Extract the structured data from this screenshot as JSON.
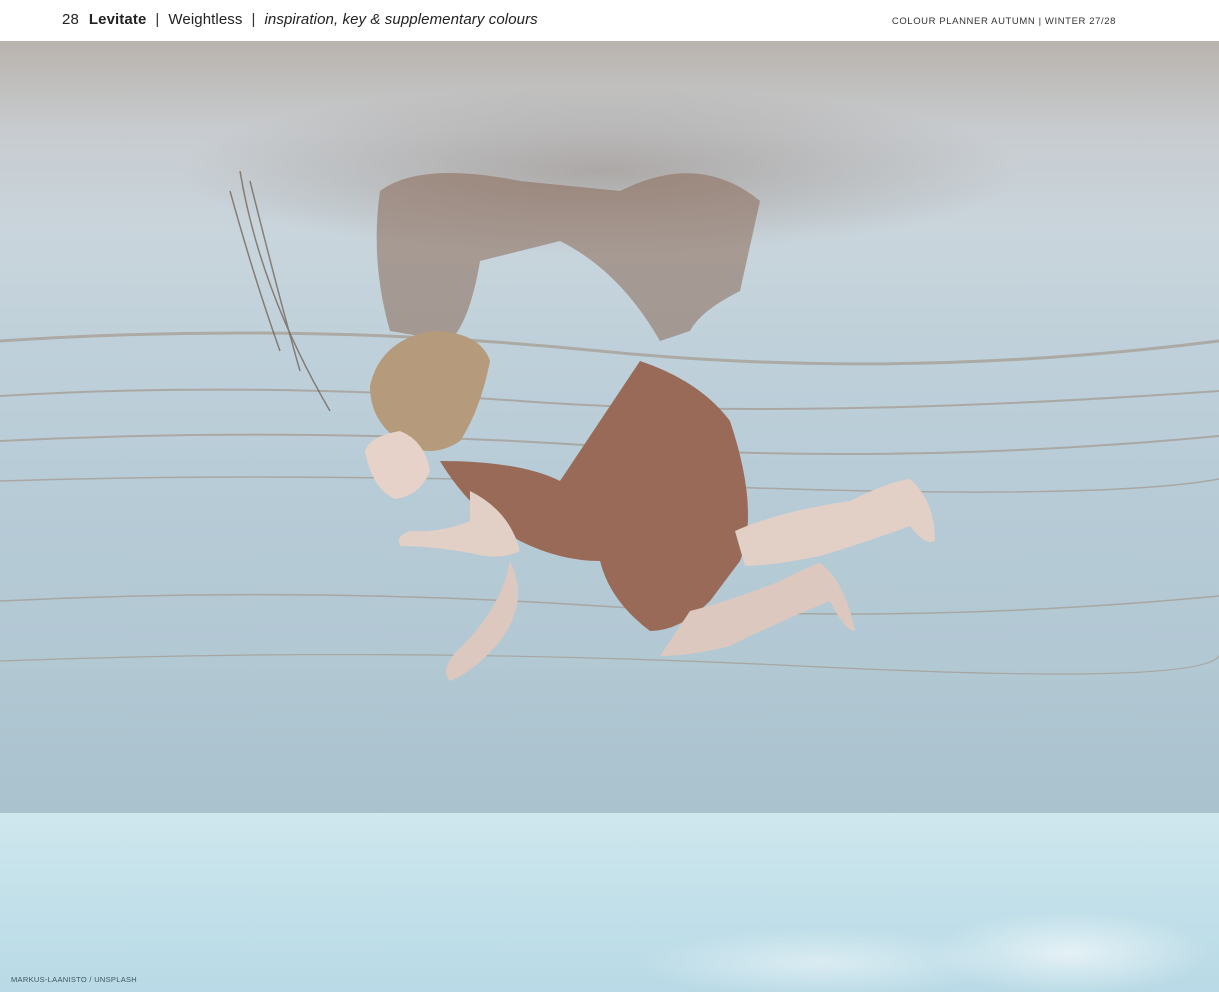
{
  "header": {
    "page_number": "28",
    "title": "Levitate",
    "separator": "|",
    "subtitle": "Weightless",
    "description": "inspiration, key & supplementary colours",
    "publication": "COLOUR PLANNER  AUTUMN | WINTER 27/28"
  },
  "photo": {
    "credit": "MARKUS-LAANISTO / UNSPLASH",
    "colors": {
      "water": "#b6cbd6",
      "sand": "#b9b3ad",
      "sky": "#c2e0ea",
      "dress": "#9a6a58",
      "skin": "#e2cfc6",
      "hair": "#b59a7c"
    }
  }
}
